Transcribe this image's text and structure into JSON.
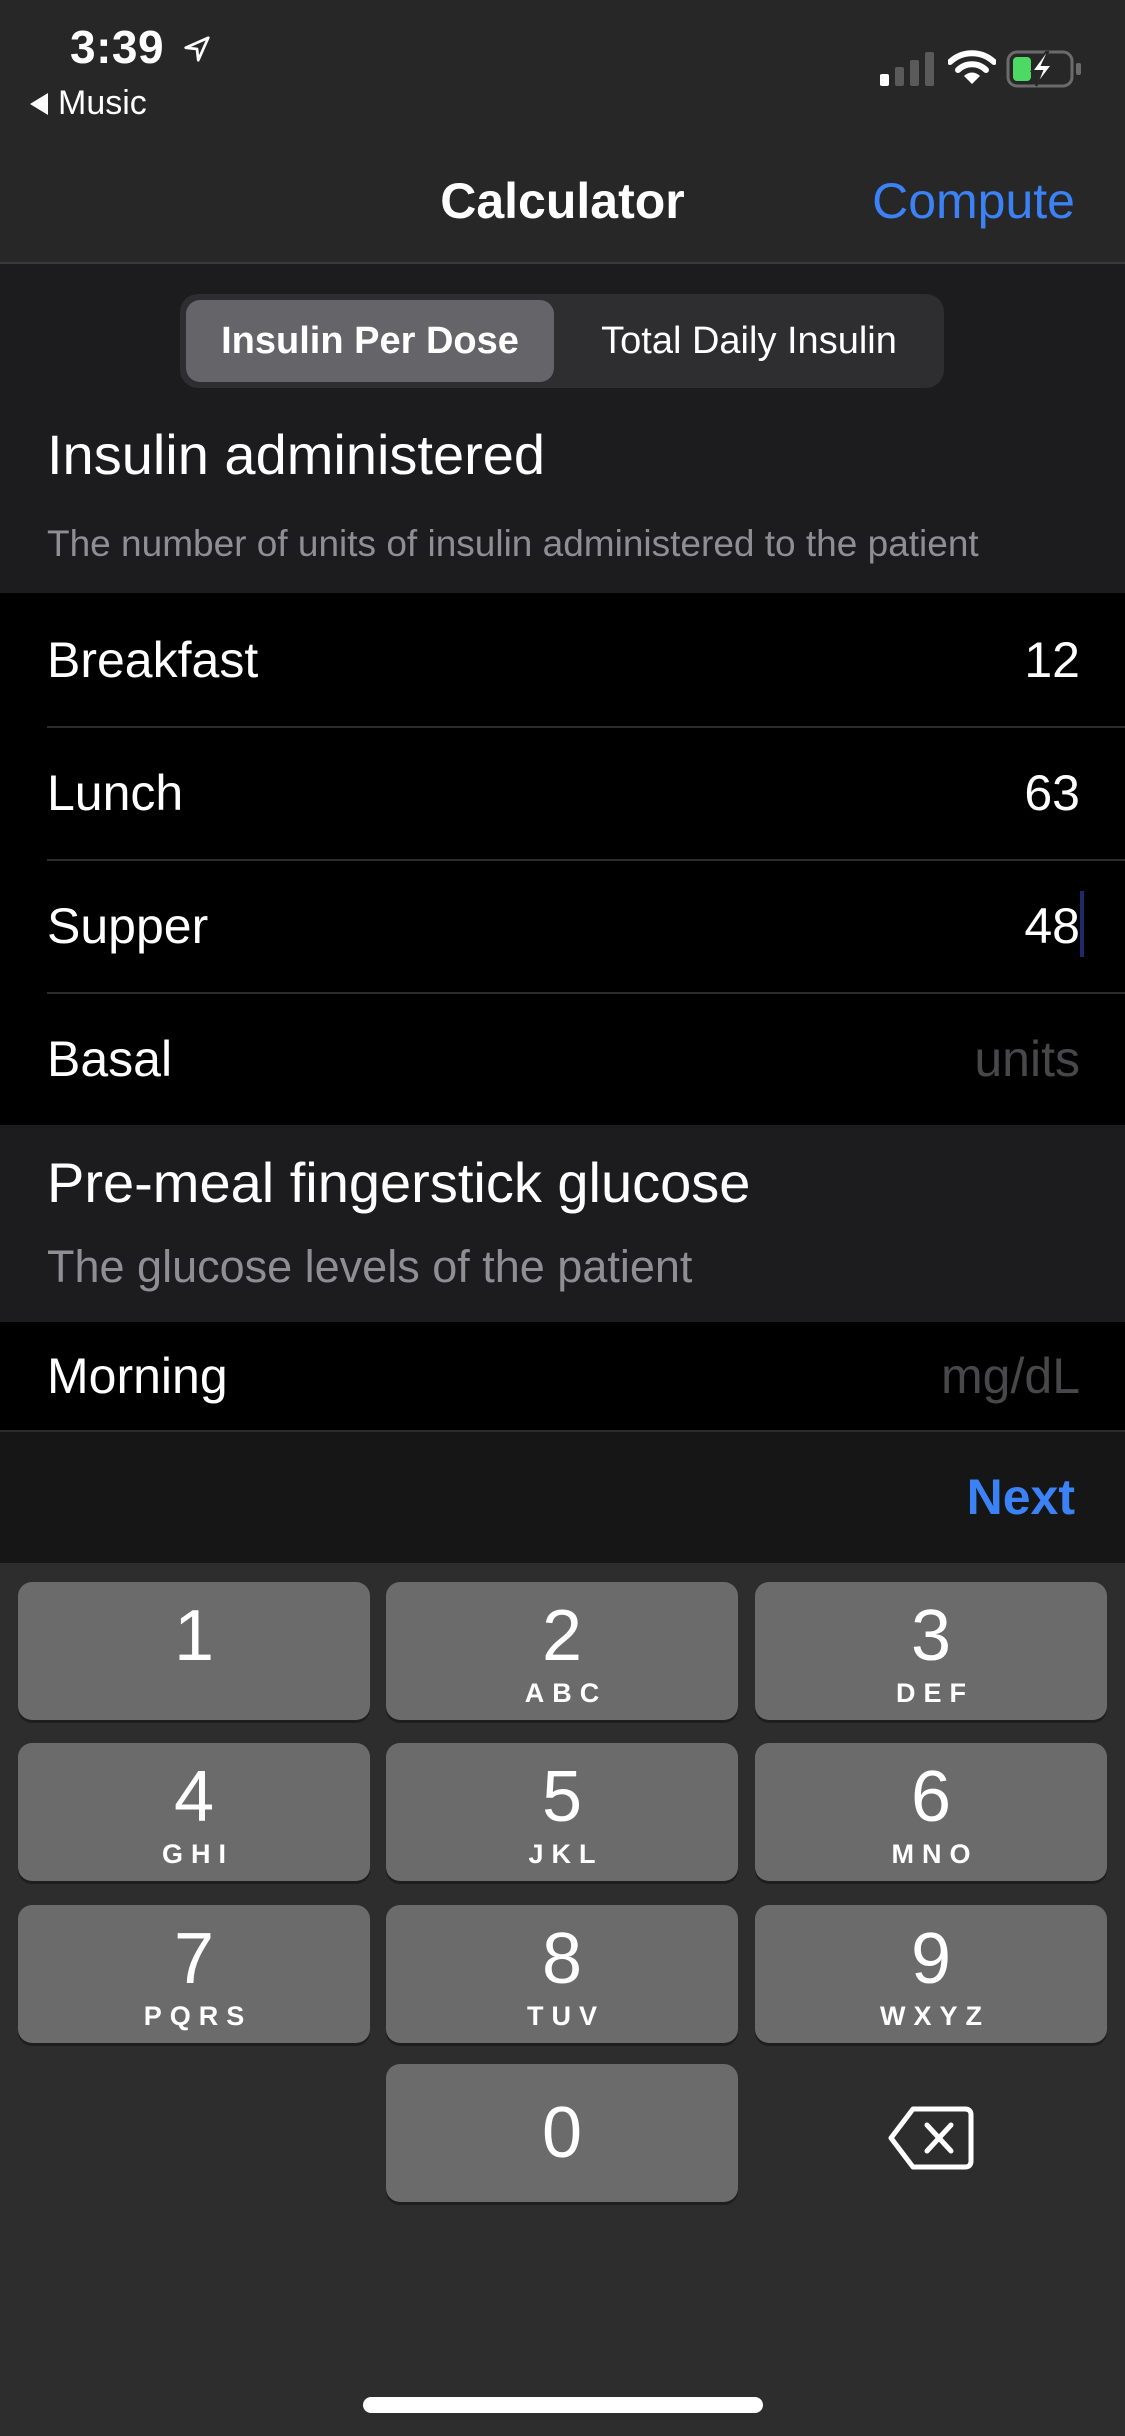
{
  "status_bar": {
    "time": "3:39",
    "location_icon": "location-arrow-icon",
    "back_app": "Music",
    "signal_icon": "cellular-signal-icon",
    "wifi_icon": "wifi-icon",
    "battery_icon": "battery-charging-icon"
  },
  "nav": {
    "title": "Calculator",
    "compute_label": "Compute",
    "accent_color": "#3b82f6"
  },
  "segmented": {
    "options": [
      "Insulin Per Dose",
      "Total Daily Insulin"
    ],
    "selected": "Insulin Per Dose"
  },
  "sections": [
    {
      "title": "Insulin administered",
      "description": "The number of units of insulin administered to the patient",
      "rows": [
        {
          "label": "Breakfast",
          "value": "12",
          "placeholder": "units"
        },
        {
          "label": "Lunch",
          "value": "63",
          "placeholder": "units"
        },
        {
          "label": "Supper",
          "value": "48",
          "placeholder": "units",
          "focused": true
        },
        {
          "label": "Basal",
          "value": "",
          "placeholder": "units"
        }
      ]
    },
    {
      "title": "Pre-meal fingerstick glucose",
      "description": "The glucose levels of the patient",
      "rows": [
        {
          "label": "Morning",
          "value": "",
          "placeholder": "mg/dL"
        }
      ]
    }
  ],
  "toolbar": {
    "next_label": "Next"
  },
  "keypad": {
    "keys": [
      {
        "num": "1",
        "letters": ""
      },
      {
        "num": "2",
        "letters": "ABC"
      },
      {
        "num": "3",
        "letters": "DEF"
      },
      {
        "num": "4",
        "letters": "GHI"
      },
      {
        "num": "5",
        "letters": "JKL"
      },
      {
        "num": "6",
        "letters": "MNO"
      },
      {
        "num": "7",
        "letters": "PQRS"
      },
      {
        "num": "8",
        "letters": "TUV"
      },
      {
        "num": "9",
        "letters": "WXYZ"
      },
      {
        "num": "0",
        "letters": ""
      }
    ],
    "delete_icon": "backspace-icon"
  }
}
